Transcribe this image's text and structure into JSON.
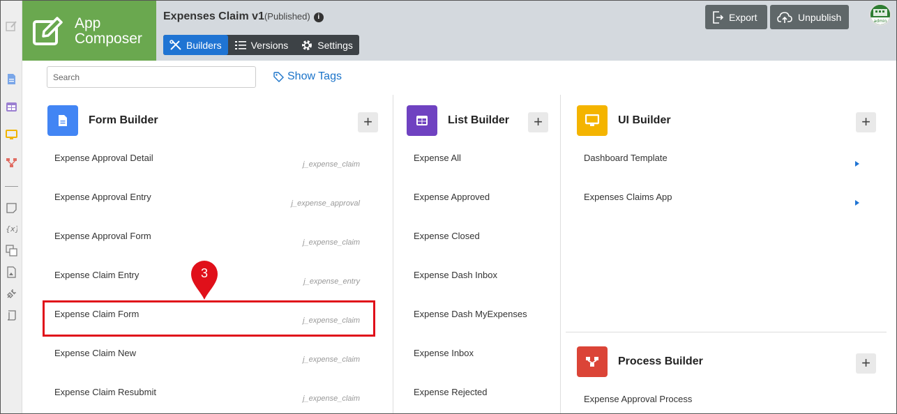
{
  "header": {
    "brand_line1": "App",
    "brand_line2": "Composer",
    "app_name": "Expenses Claim v1",
    "app_status": "(Published)",
    "tabs": [
      {
        "label": "Builders",
        "icon": "tools-icon",
        "active": true
      },
      {
        "label": "Versions",
        "icon": "list-icon",
        "active": false
      },
      {
        "label": "Settings",
        "icon": "gear-icon",
        "active": false
      }
    ],
    "export_label": "Export",
    "unpublish_label": "Unpublish",
    "avatar_label": "admin"
  },
  "toolbar": {
    "search_placeholder": "Search",
    "show_tags_label": "Show Tags"
  },
  "form_builder": {
    "title": "Form Builder",
    "color": "#4285f4",
    "items": [
      {
        "label": "Expense Approval Detail",
        "tag": "j_expense_claim"
      },
      {
        "label": "Expense Approval Entry",
        "tag": "j_expense_approval"
      },
      {
        "label": "Expense Approval Form",
        "tag": "j_expense_claim"
      },
      {
        "label": "Expense Claim Entry",
        "tag": "j_expense_entry"
      },
      {
        "label": "Expense Claim Form",
        "tag": "j_expense_claim"
      },
      {
        "label": "Expense Claim New",
        "tag": "j_expense_claim"
      },
      {
        "label": "Expense Claim Resubmit",
        "tag": "j_expense_claim"
      }
    ]
  },
  "list_builder": {
    "title": "List Builder",
    "color": "#6f42c1",
    "items": [
      "Expense All",
      "Expense Approved",
      "Expense Closed",
      "Expense Dash Inbox",
      "Expense Dash MyExpenses",
      "Expense Inbox",
      "Expense Rejected"
    ]
  },
  "ui_builder": {
    "title": "UI Builder",
    "color": "#f4b400",
    "items": [
      "Dashboard Template",
      "Expenses Claims App"
    ]
  },
  "process_builder": {
    "title": "Process Builder",
    "color": "#db4437",
    "items": [
      "Expense Approval Process"
    ]
  },
  "annotation": {
    "step_number": "3",
    "color": "#e0101a"
  }
}
